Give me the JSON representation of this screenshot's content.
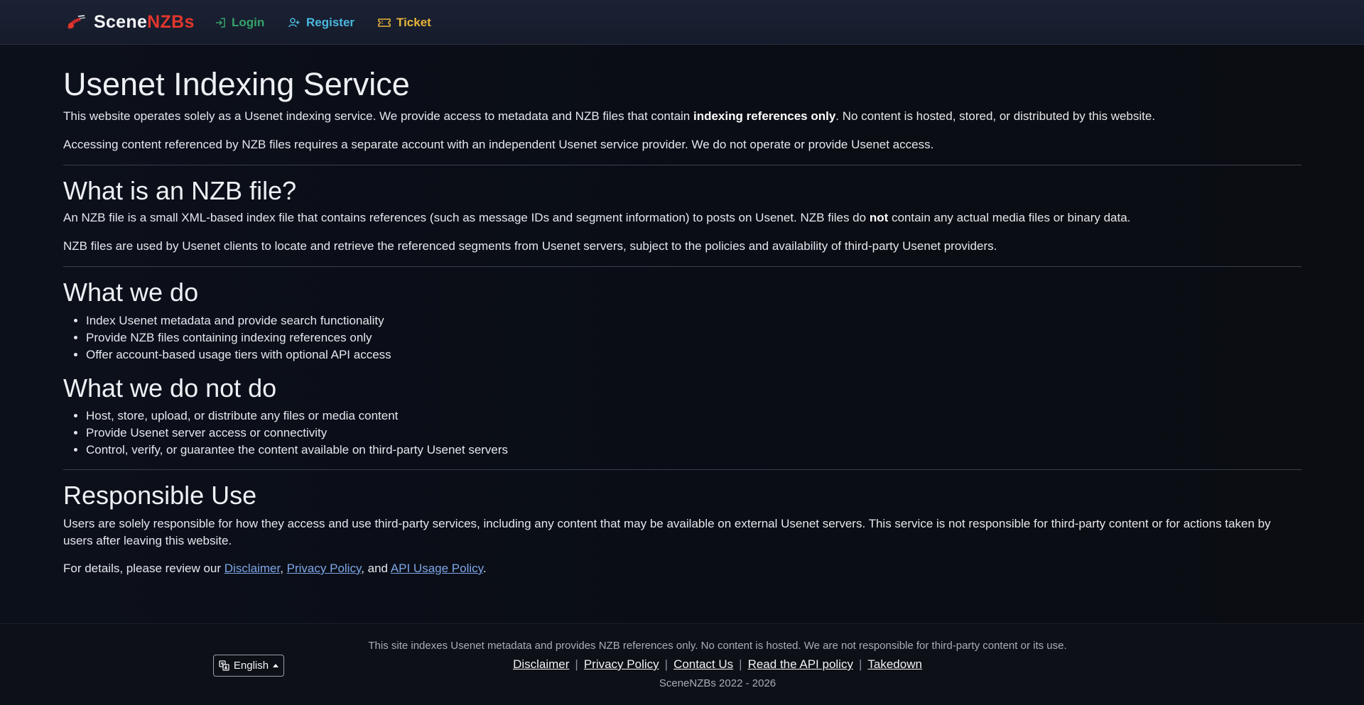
{
  "nav": {
    "brand_scene": "Scene",
    "brand_nzbs": "NZBs",
    "login": "Login",
    "register": "Register",
    "ticket": "Ticket"
  },
  "intro": {
    "title": "Usenet Indexing Service",
    "p1_before": "This website operates solely as a Usenet indexing service. We provide access to metadata and NZB files that contain ",
    "p1_bold": "indexing references only",
    "p1_after": ". No content is hosted, stored, or distributed by this website.",
    "p2": "Accessing content referenced by NZB files requires a separate account with an independent Usenet service provider. We do not operate or provide Usenet access."
  },
  "nzb": {
    "title": "What is an NZB file?",
    "p1_before": "An NZB file is a small XML-based index file that contains references (such as message IDs and segment information) to posts on Usenet. NZB files do ",
    "p1_bold": "not",
    "p1_after": " contain any actual media files or binary data.",
    "p2": "NZB files are used by Usenet clients to locate and retrieve the referenced segments from Usenet servers, subject to the policies and availability of third-party Usenet providers."
  },
  "do": {
    "title": "What we do",
    "items": [
      "Index Usenet metadata and provide search functionality",
      "Provide NZB files containing indexing references only",
      "Offer account-based usage tiers with optional API access"
    ]
  },
  "dont": {
    "title": "What we do not do",
    "items": [
      "Host, store, upload, or distribute any files or media content",
      "Provide Usenet server access or connectivity",
      "Control, verify, or guarantee the content available on third-party Usenet servers"
    ]
  },
  "responsible": {
    "title": "Responsible Use",
    "p1": "Users are solely responsible for how they access and use third-party services, including any content that may be available on external Usenet servers. This service is not responsible for third-party content or for actions taken by users after leaving this website.",
    "p2_before": "For details, please review our ",
    "link_disclaimer": "Disclaimer",
    "comma": ",",
    "link_privacy": "Privacy Policy",
    "and": ", and",
    "link_api": "API Usage Policy",
    "period": "."
  },
  "footer": {
    "language": "English",
    "note": "This site indexes Usenet metadata and provides NZB references only. No content is hosted. We are not responsible for third-party content or its use.",
    "links": [
      "Disclaimer",
      "Privacy Policy",
      "Contact Us",
      "Read the API policy",
      "Takedown"
    ],
    "separator": "|",
    "copyright": "SceneNZBs 2022 - 2026"
  },
  "colors": {
    "accent_red": "#e2362c",
    "login_green": "#35a36b",
    "register_blue": "#4ab7df",
    "ticket_yellow": "#e7b43a",
    "link_blue": "#7ea6e6"
  }
}
